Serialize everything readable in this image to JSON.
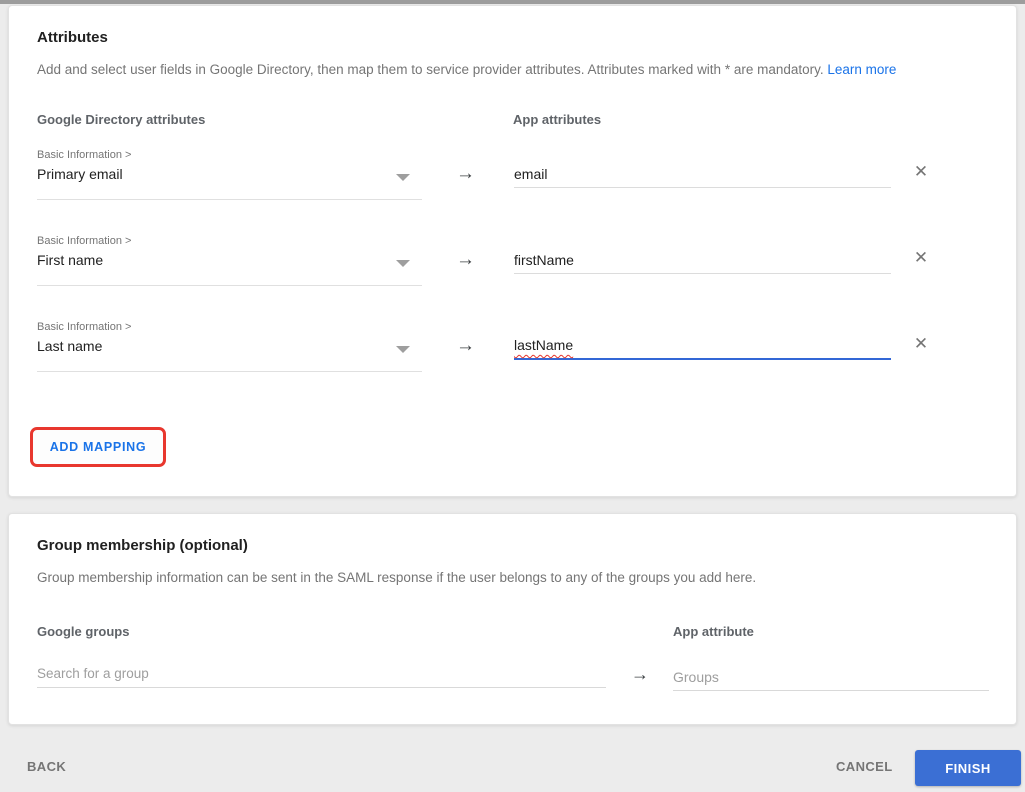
{
  "attributes_card": {
    "title": "Attributes",
    "description": "Add and select user fields in Google Directory, then map them to service provider attributes. Attributes marked with * are mandatory.",
    "learn_more_label": "Learn more",
    "left_header": "Google Directory attributes",
    "right_header": "App attributes",
    "rows": [
      {
        "category": "Basic Information >",
        "field": "Primary email",
        "app_value": "email"
      },
      {
        "category": "Basic Information >",
        "field": "First name",
        "app_value": "firstName"
      },
      {
        "category": "Basic Information >",
        "field": "Last name",
        "app_value": "lastName"
      }
    ],
    "add_mapping_label": "ADD MAPPING"
  },
  "group_card": {
    "title": "Group membership (optional)",
    "description": "Group membership information can be sent in the SAML response if the user belongs to any of the groups you add here.",
    "left_header": "Google groups",
    "right_header": "App attribute",
    "search_placeholder": "Search for a group",
    "app_placeholder": "Groups"
  },
  "footer": {
    "back_label": "BACK",
    "cancel_label": "CANCEL",
    "finish_label": "FINISH"
  },
  "icons": {
    "map_arrow": "→",
    "remove": "✕"
  },
  "colors": {
    "link_blue": "#1a73e8",
    "finish_blue": "#3b6fd4",
    "focus_underline_blue": "#3367d6",
    "annotation_red": "#e8372e",
    "spellcheck_red": "#e5352b",
    "page_background": "#ececec"
  }
}
